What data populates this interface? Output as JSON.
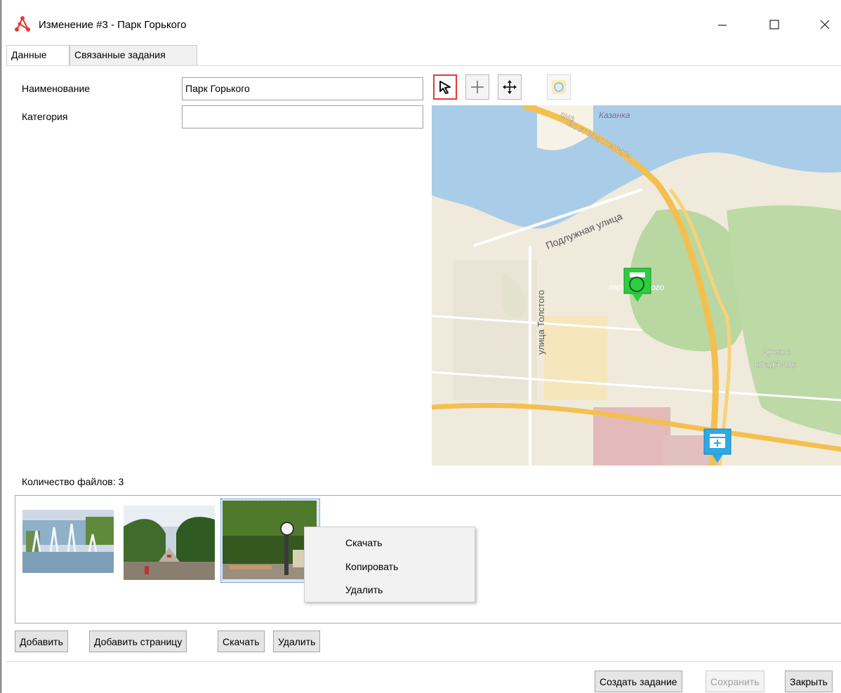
{
  "window": {
    "title": "Изменение #3 - Парк Горького",
    "min_glyph": "—",
    "max_glyph": "☐",
    "close_glyph": "✕"
  },
  "tabs": [
    {
      "label": "Данные",
      "active": true
    },
    {
      "label": "Связанные задания",
      "active": false
    }
  ],
  "form": {
    "name_label": "Наименование",
    "name_value": "Парк Горького",
    "category_label": "Категория",
    "category_value": ""
  },
  "map_tools": [
    {
      "icon": "select-arrow-icon",
      "active": true
    },
    {
      "icon": "add-point-icon",
      "active": false
    },
    {
      "icon": "pan-move-icon",
      "active": false
    },
    {
      "icon": "zoom-search-icon",
      "active": false
    }
  ],
  "map": {
    "labels": {
      "kazanka": "Казанка",
      "most": "мост Миллениум",
      "bridge_prefix": "ана",
      "podluzhnaya": "Подлужная улица",
      "tolstogo": "улица Толстого",
      "park": "парк Горького",
      "arskoe_1": "Арское",
      "arskoe_2": "кладбище"
    },
    "colors": {
      "water": "#a9cde8",
      "land": "#efeadc",
      "park": "#b9d7a1",
      "road": "#f3c04f",
      "marker_green": "#2ecc40",
      "marker_blue": "#2fa8e8"
    }
  },
  "files": {
    "count_label": "Количество файлов: 3",
    "thumbnails": [
      {
        "name": "fountain-photo"
      },
      {
        "name": "alley-photo"
      },
      {
        "name": "clock-photo",
        "selected": true
      }
    ]
  },
  "context_menu": {
    "items": [
      "Скачать",
      "Копировать",
      "Удалить"
    ]
  },
  "file_buttons": {
    "add": "Добавить",
    "add_page": "Добавить страницу",
    "download": "Скачать",
    "delete": "Удалить"
  },
  "footer_buttons": {
    "create_task": "Создать задание",
    "save": "Сохранить",
    "close": "Закрыть"
  }
}
